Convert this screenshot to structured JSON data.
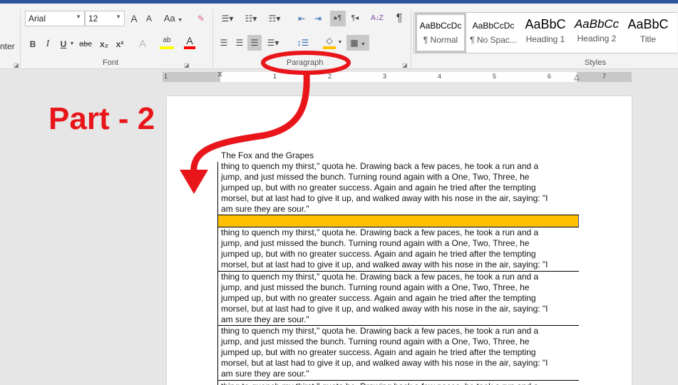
{
  "ribbon": {
    "clipboard_partial": "nter",
    "font": {
      "name": "Arial",
      "size": "12",
      "group_label": "Font",
      "grow": "A",
      "shrink": "A",
      "change_case": "Aa",
      "bold": "B",
      "italic": "I",
      "underline": "U",
      "strikethrough": "abc",
      "subscript": "x₂",
      "superscript": "x²",
      "text_effects": "A",
      "highlight": "ab",
      "font_color": "A",
      "highlight_color": "#ffff00",
      "font_color_value": "#ff0000"
    },
    "paragraph": {
      "group_label": "Paragraph",
      "shading_color": "#ffc000",
      "show_marks": "¶",
      "ltr": "▸¶",
      "rtl": "¶◂",
      "sort": "A↓Z"
    },
    "styles": {
      "group_label": "Styles",
      "items": [
        {
          "preview": "AaBbCcDc",
          "name": "¶ Normal"
        },
        {
          "preview": "AaBbCcDc",
          "name": "¶ No Spac..."
        },
        {
          "preview": "AaBbC",
          "name": "Heading 1"
        },
        {
          "preview": "AaBbCc",
          "name": "Heading 2"
        },
        {
          "preview": "AaBbC",
          "name": "Title"
        }
      ]
    }
  },
  "ruler": {
    "marks": [
      "1",
      "1",
      "2",
      "3",
      "4",
      "5",
      "6",
      "7"
    ]
  },
  "annotation": {
    "text": "Part - 2",
    "color": "#e8161b"
  },
  "document": {
    "title": "The Fox and the Grapes",
    "paragraph_lines": [
      "thing to quench my thirst,\" quota he.   Drawing back a few paces, he took a run and a",
      "jump, and just missed the bunch. Turning round again with a One, Two, Three, he",
      "jumped up, but with no greater success. Again and again he tried after the tempting",
      "morsel, but at last had to give it up, and walked away with his nose in the air, saying: \"I",
      "am sure they are sour.\""
    ],
    "selected_row_color": "#ffc000"
  }
}
